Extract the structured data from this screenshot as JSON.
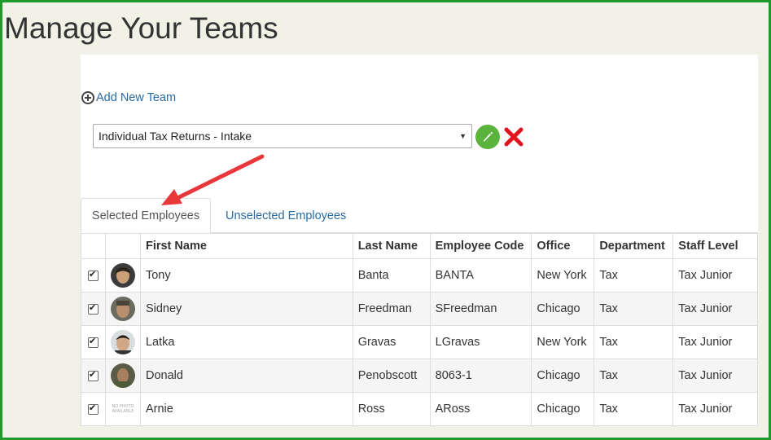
{
  "page": {
    "title": "Manage Your Teams"
  },
  "add_team": {
    "label": "Add New Team",
    "icon": "plus-circle-icon"
  },
  "team_select": {
    "value": "Individual Tax Returns - Intake"
  },
  "actions": {
    "edit_icon": "pencil-icon",
    "delete_icon": "x-icon",
    "edit_color": "#5ab33a",
    "delete_color": "#e0141e"
  },
  "tabs": [
    {
      "label": "Selected Employees",
      "active": true
    },
    {
      "label": "Unselected Employees",
      "active": false
    }
  ],
  "table": {
    "columns": [
      "",
      "",
      "First Name",
      "Last Name",
      "Employee Code",
      "Office",
      "Department",
      "Staff Level"
    ],
    "rows": [
      {
        "checked": true,
        "avatar": "photo",
        "first": "Tony",
        "last": "Banta",
        "code": "BANTA",
        "office": "New York",
        "department": "Tax",
        "level": "Tax Junior"
      },
      {
        "checked": true,
        "avatar": "photo",
        "first": "Sidney",
        "last": "Freedman",
        "code": "SFreedman",
        "office": "Chicago",
        "department": "Tax",
        "level": "Tax Junior"
      },
      {
        "checked": true,
        "avatar": "photo",
        "first": "Latka",
        "last": "Gravas",
        "code": "LGravas",
        "office": "New York",
        "department": "Tax",
        "level": "Tax Junior"
      },
      {
        "checked": true,
        "avatar": "photo",
        "first": "Donald",
        "last": "Penobscott",
        "code": "8063-1",
        "office": "Chicago",
        "department": "Tax",
        "level": "Tax Junior"
      },
      {
        "checked": true,
        "avatar": "no-photo",
        "no_photo_text": "NO PHOTO AVAILABLE",
        "first": "Arnie",
        "last": "Ross",
        "code": "ARoss",
        "office": "Chicago",
        "department": "Tax",
        "level": "Tax Junior"
      }
    ]
  },
  "colors": {
    "link": "#2a6aa0",
    "frame_border": "#1e9a2c",
    "annotation_arrow": "#e8383b"
  }
}
